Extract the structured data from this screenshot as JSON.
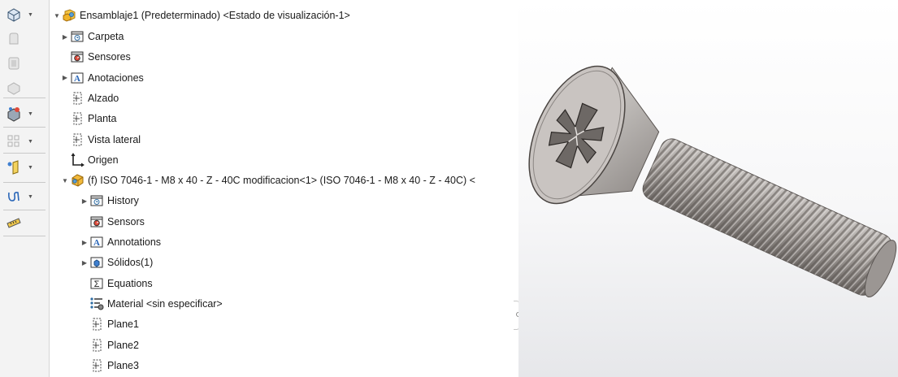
{
  "colors": {
    "toolbar_bg": "#f3f3f3",
    "tree_bg": "#ffffff",
    "viewport_top": "#ffffff",
    "viewport_bottom": "#e6e7ea",
    "screw_metal": "#a8a29e"
  },
  "toolbar": {
    "buttons": [
      {
        "icon": "view-orientation-icon",
        "has_dropdown": true
      },
      {
        "icon": "edit-component-icon",
        "has_dropdown": false
      },
      {
        "icon": "hide-show-components-icon",
        "has_dropdown": false
      },
      {
        "icon": "appearance-icon",
        "has_dropdown": false
      },
      {
        "icon": "display-style-icon",
        "has_dropdown": true
      },
      {
        "icon": "linear-pattern-icon",
        "has_dropdown": true
      },
      {
        "icon": "reference-geometry-icon",
        "has_dropdown": true
      },
      {
        "icon": "curves-icon",
        "has_dropdown": true
      },
      {
        "icon": "measure-icon",
        "has_dropdown": false
      }
    ]
  },
  "tree": {
    "root": {
      "label": "Ensamblaje1 (Predeterminado) <Estado de visualización-1>",
      "icon": "assembly-icon"
    },
    "items": [
      {
        "label": "Carpeta",
        "icon": "history-folder-icon",
        "expandable": true,
        "level": 1
      },
      {
        "label": "Sensores",
        "icon": "sensors-icon",
        "expandable": false,
        "level": 1
      },
      {
        "label": "Anotaciones",
        "icon": "annotations-icon",
        "expandable": true,
        "level": 1
      },
      {
        "label": "Alzado",
        "icon": "plane-icon",
        "expandable": false,
        "level": 1
      },
      {
        "label": "Planta",
        "icon": "plane-icon",
        "expandable": false,
        "level": 1
      },
      {
        "label": "Vista lateral",
        "icon": "plane-icon",
        "expandable": false,
        "level": 1
      },
      {
        "label": "Origen",
        "icon": "origin-icon",
        "expandable": false,
        "level": 1
      },
      {
        "label": "(f) ISO 7046-1 - M8 x 40 - Z - 40C modificacion<1> (ISO 7046-1 - M8 x 40 - Z - 40C) <",
        "icon": "part-icon",
        "expandable": true,
        "expanded": true,
        "level": 1
      },
      {
        "label": "History",
        "icon": "history-folder-icon",
        "expandable": true,
        "level": 2
      },
      {
        "label": "Sensors",
        "icon": "sensors-icon",
        "expandable": false,
        "level": 2
      },
      {
        "label": "Annotations",
        "icon": "annotations-icon",
        "expandable": true,
        "level": 2
      },
      {
        "label": "Sólidos(1)",
        "icon": "solid-bodies-icon",
        "expandable": true,
        "level": 2
      },
      {
        "label": "Equations",
        "icon": "equations-icon",
        "expandable": false,
        "level": 2
      },
      {
        "label": "Material <sin especificar>",
        "icon": "material-icon",
        "expandable": false,
        "level": 2
      },
      {
        "label": "Plane1",
        "icon": "plane-icon",
        "expandable": false,
        "level": 2
      },
      {
        "label": "Plane2",
        "icon": "plane-icon",
        "expandable": false,
        "level": 2
      },
      {
        "label": "Plane3",
        "icon": "plane-icon",
        "expandable": false,
        "level": 2
      }
    ]
  }
}
